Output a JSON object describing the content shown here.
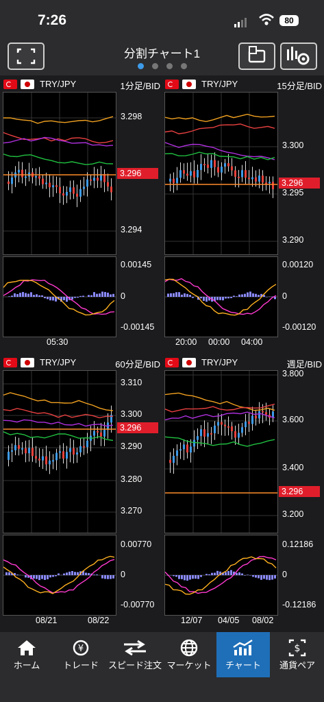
{
  "status": {
    "time": "7:26",
    "battery": "80"
  },
  "header": {
    "title": "分割チャート1",
    "page_count": 4,
    "active_page": 0
  },
  "panels": [
    {
      "pair": "TRY/JPY",
      "timeframe": "1分足/BID",
      "yticks": [
        "3.298",
        "3.294"
      ],
      "price": "3.296",
      "macd_ticks": [
        "0.00145",
        "0",
        "-0.00145"
      ],
      "xticks": [
        "05:30"
      ]
    },
    {
      "pair": "TRY/JPY",
      "timeframe": "15分足/BID",
      "yticks": [
        "3.300",
        "3.295",
        "3.290"
      ],
      "price": "3.296",
      "macd_ticks": [
        "0.00120",
        "0",
        "-0.00120"
      ],
      "xticks": [
        "20:00",
        "00:00",
        "04:00"
      ]
    },
    {
      "pair": "TRY/JPY",
      "timeframe": "60分足/BID",
      "yticks": [
        "3.310",
        "3.300",
        "3.290",
        "3.280",
        "3.270"
      ],
      "price": "3.296",
      "macd_ticks": [
        "0.00770",
        "0",
        "-0.00770"
      ],
      "xticks": [
        "08/21",
        "08/22"
      ]
    },
    {
      "pair": "TRY/JPY",
      "timeframe": "週足/BID",
      "yticks": [
        "3.800",
        "3.600",
        "3.400",
        "3.200"
      ],
      "price": "3.296",
      "macd_ticks": [
        "0.12186",
        "0",
        "-0.12186"
      ],
      "xticks": [
        "12/07",
        "04/05",
        "08/02"
      ]
    }
  ],
  "tabs": [
    {
      "label": "ホーム",
      "icon": "home-icon"
    },
    {
      "label": "トレード",
      "icon": "yen-exchange-icon"
    },
    {
      "label": "スピード注文",
      "icon": "arrows-icon"
    },
    {
      "label": "マーケット",
      "icon": "globe-icon"
    },
    {
      "label": "チャート",
      "icon": "chart-icon"
    },
    {
      "label": "通貨ペア",
      "icon": "currency-icon"
    }
  ],
  "colors": {
    "accent": "#1f6fb8",
    "price_label": "#e01e2b",
    "candle_up": "#3d9be9",
    "candle_down": "#e8413a",
    "ma_short": "#f0a020",
    "ma_mid": "#e84040",
    "ma_long": "#b030e0",
    "ma_longest": "#20c040"
  }
}
